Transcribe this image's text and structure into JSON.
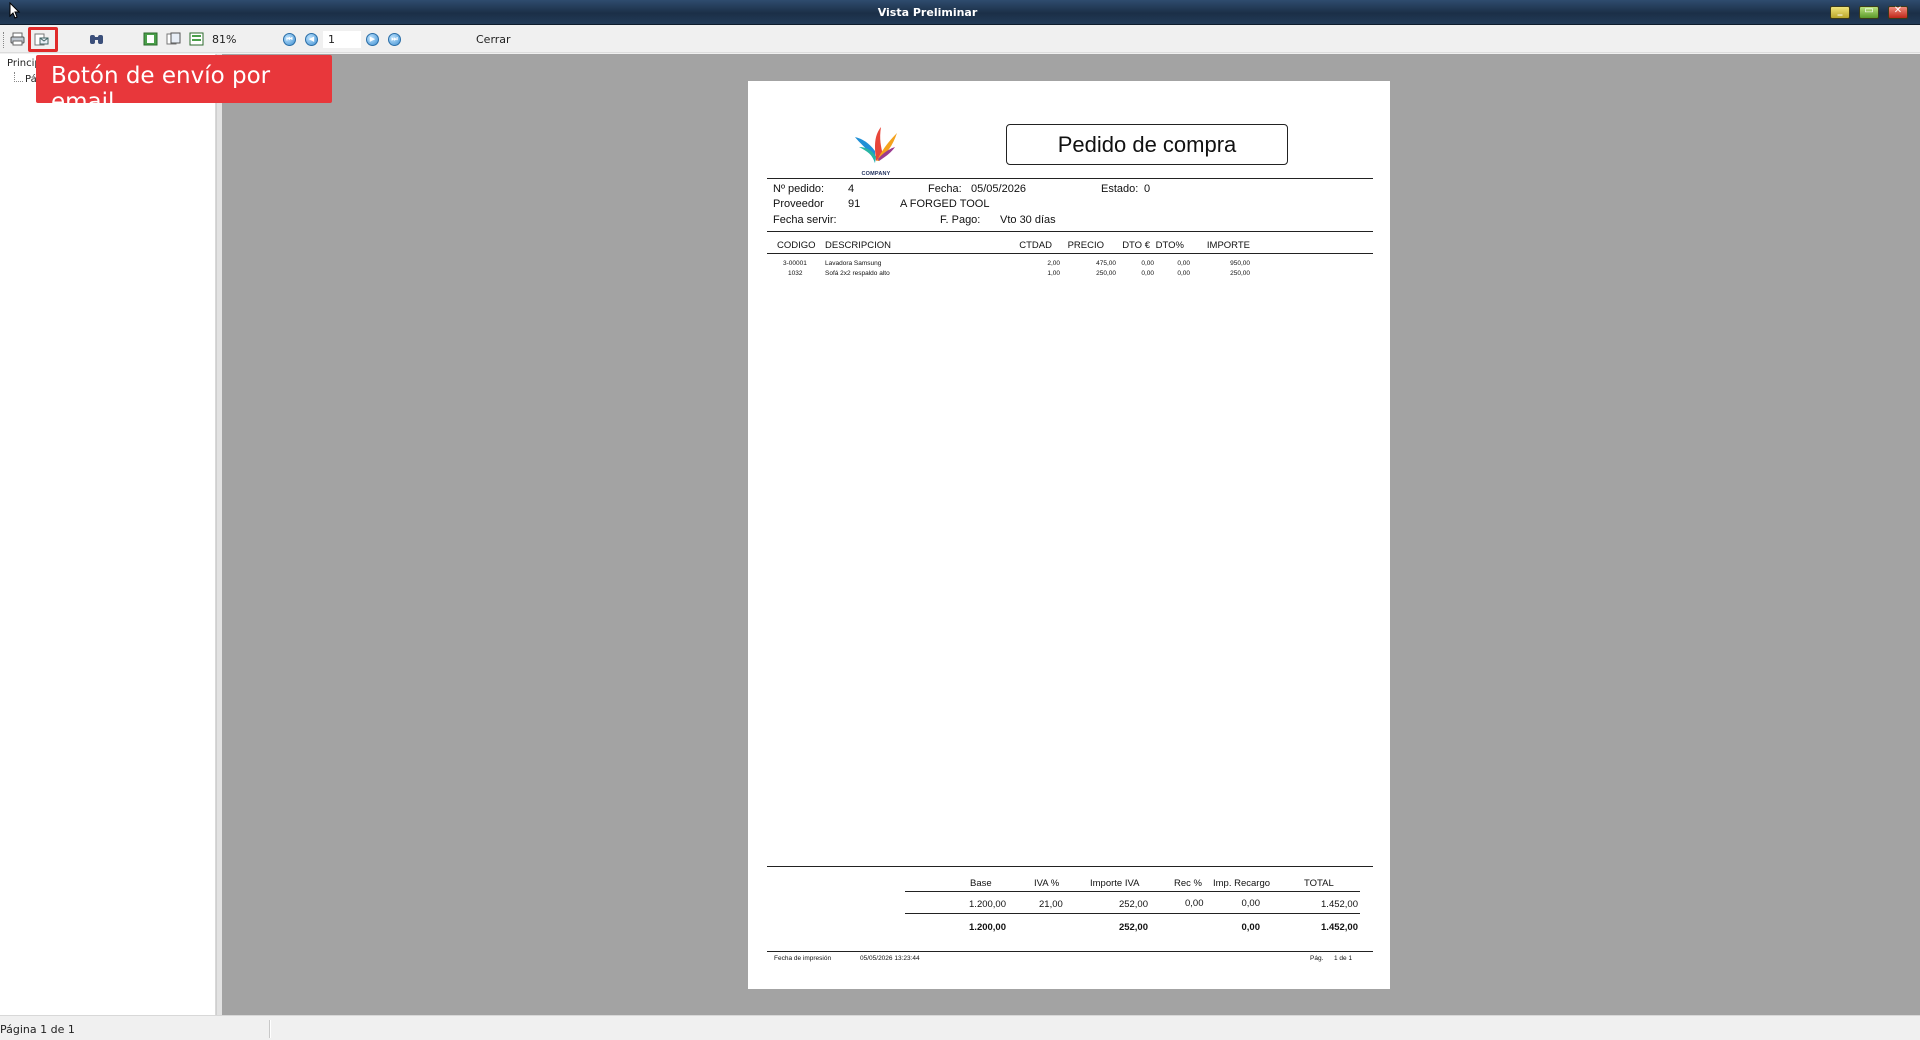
{
  "window": {
    "title": "Vista Preliminar"
  },
  "toolbar": {
    "zoom": "81%",
    "page_number": "1",
    "close_label": "Cerrar"
  },
  "callout": {
    "text": "Botón de envío por email"
  },
  "tree": {
    "root": "Princip",
    "child": "Pá"
  },
  "document": {
    "title": "Pedido de compra",
    "logo_text": "COMPANY",
    "header": {
      "order_label": "Nº pedido:",
      "order_value": "4",
      "date_label": "Fecha:",
      "date_value": "05/05/2026",
      "status_label": "Estado:",
      "status_value": "0",
      "supplier_label": "Proveedor",
      "supplier_id": "91",
      "supplier_name": "A FORGED TOOL",
      "serve_label": "Fecha servir:",
      "payment_label": "F. Pago:",
      "payment_value": "Vto 30 días"
    },
    "columns": [
      "CODIGO",
      "DESCRIPCION",
      "CTDAD",
      "PRECIO",
      "DTO €",
      "DTO%",
      "IMPORTE"
    ],
    "rows": [
      {
        "code": "3-00001",
        "description": "Lavadora Samsung",
        "qty": "2,00",
        "price": "475,00",
        "dto_eur": "0,00",
        "dto_pct": "0,00",
        "amount": "950,00"
      },
      {
        "code": "1032",
        "description": "Sofá 2x2 respaldo alto",
        "qty": "1,00",
        "price": "250,00",
        "dto_eur": "0,00",
        "dto_pct": "0,00",
        "amount": "250,00"
      }
    ],
    "totals": {
      "headers": [
        "Base",
        "IVA %",
        "Importe IVA",
        "Rec %",
        "Imp. Recargo",
        "TOTAL"
      ],
      "line": {
        "base": "1.200,00",
        "iva_pct": "21,00",
        "iva_amount": "252,00",
        "rec_pct": "0,00",
        "rec_amount": "0,00",
        "total": "1.452,00"
      },
      "sum": {
        "base": "1.200,00",
        "iva_amount": "252,00",
        "rec_amount": "0,00",
        "total": "1.452,00"
      }
    },
    "footer": {
      "print_label": "Fecha de impresión",
      "print_value": "05/05/2026 13:23:44",
      "page_label": "Pág.",
      "page_value": "1 de 1"
    }
  },
  "status": {
    "text": "Página 1 de 1"
  },
  "colors": {
    "callout_bg": "#e8373b",
    "preview_bg": "#a3a3a3",
    "titlebar": "#1b2f47"
  }
}
